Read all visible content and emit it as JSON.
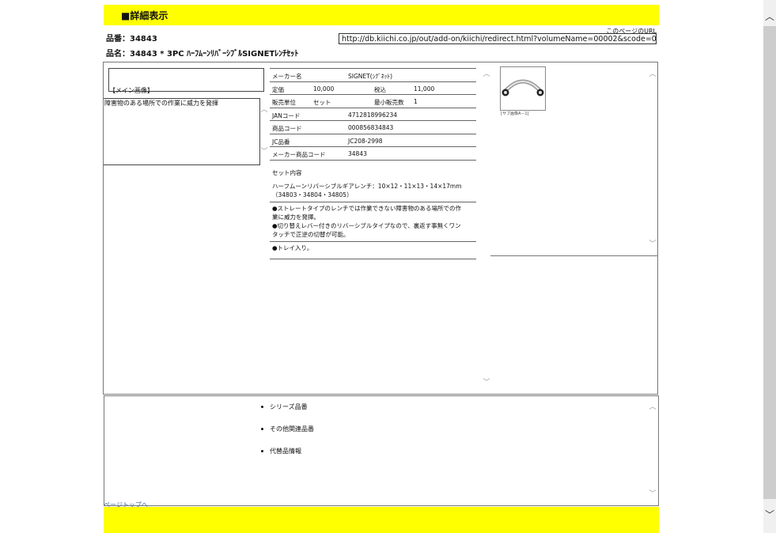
{
  "header": {
    "title": "■詳細表示"
  },
  "url": {
    "label": "このページのURL",
    "value": "http://db.kiichi.co.jp/out/add-on/kiichi/redirect.html?volumeName=00002&scode=000856834843"
  },
  "product": {
    "hinban_label": "品番：",
    "hinban": "34843",
    "hinmei_label": "品名：",
    "hinmei": "34843 * 3PC ﾊｰﾌﾑｰﾝﾘﾊﾞｰｼﾌﾞﾙSIGNETﾚﾝﾁｾｯﾄ"
  },
  "main_image": {
    "label": "【メイン画像】"
  },
  "description": "障害物のある場所での作業に威力を発揮",
  "info": {
    "maker_label": "メーカー名",
    "maker": "SIGNET(ｼｸﾞﾈｯﾄ)",
    "price_label": "定価",
    "price": "10,000",
    "tax_label": "税込",
    "tax_price": "11,000",
    "unit_label": "販売単位",
    "unit": "セット",
    "min_label": "最小販売数",
    "min": "1",
    "jan_label": "JANコード",
    "jan": "4712818996234",
    "code_label": "商品コード",
    "code": "000856834843",
    "jc_label": "JC品番",
    "jc": "JC208-2998",
    "maker_code_label": "メーカー商品コード",
    "maker_code": "34843"
  },
  "set": {
    "title": "セット内容",
    "line1": "ハーフムーンリバーシブルギアレンチ：10×12・11×13・14×17mm",
    "line2": "（34803・34804・34805）"
  },
  "features": {
    "f1a": "●ストレートタイプのレンチでは作業できない障害物のある場所での作",
    "f1b": "業に威力を発揮。",
    "f2a": "●切り替えレバー付きのリバーシブルタイプなので、裏返す事無くワン",
    "f2b": "タッチで正逆の切替が可能。",
    "f3": "●トレイ入り。"
  },
  "sub_image": {
    "caption": "[サブ画像A－1]"
  },
  "links": {
    "series": "シリーズ品番",
    "related": "その他関連品番",
    "alternative": "代替品情報"
  },
  "pagetop": "ページトップへ",
  "colors": {
    "banner": "#ffff00"
  }
}
